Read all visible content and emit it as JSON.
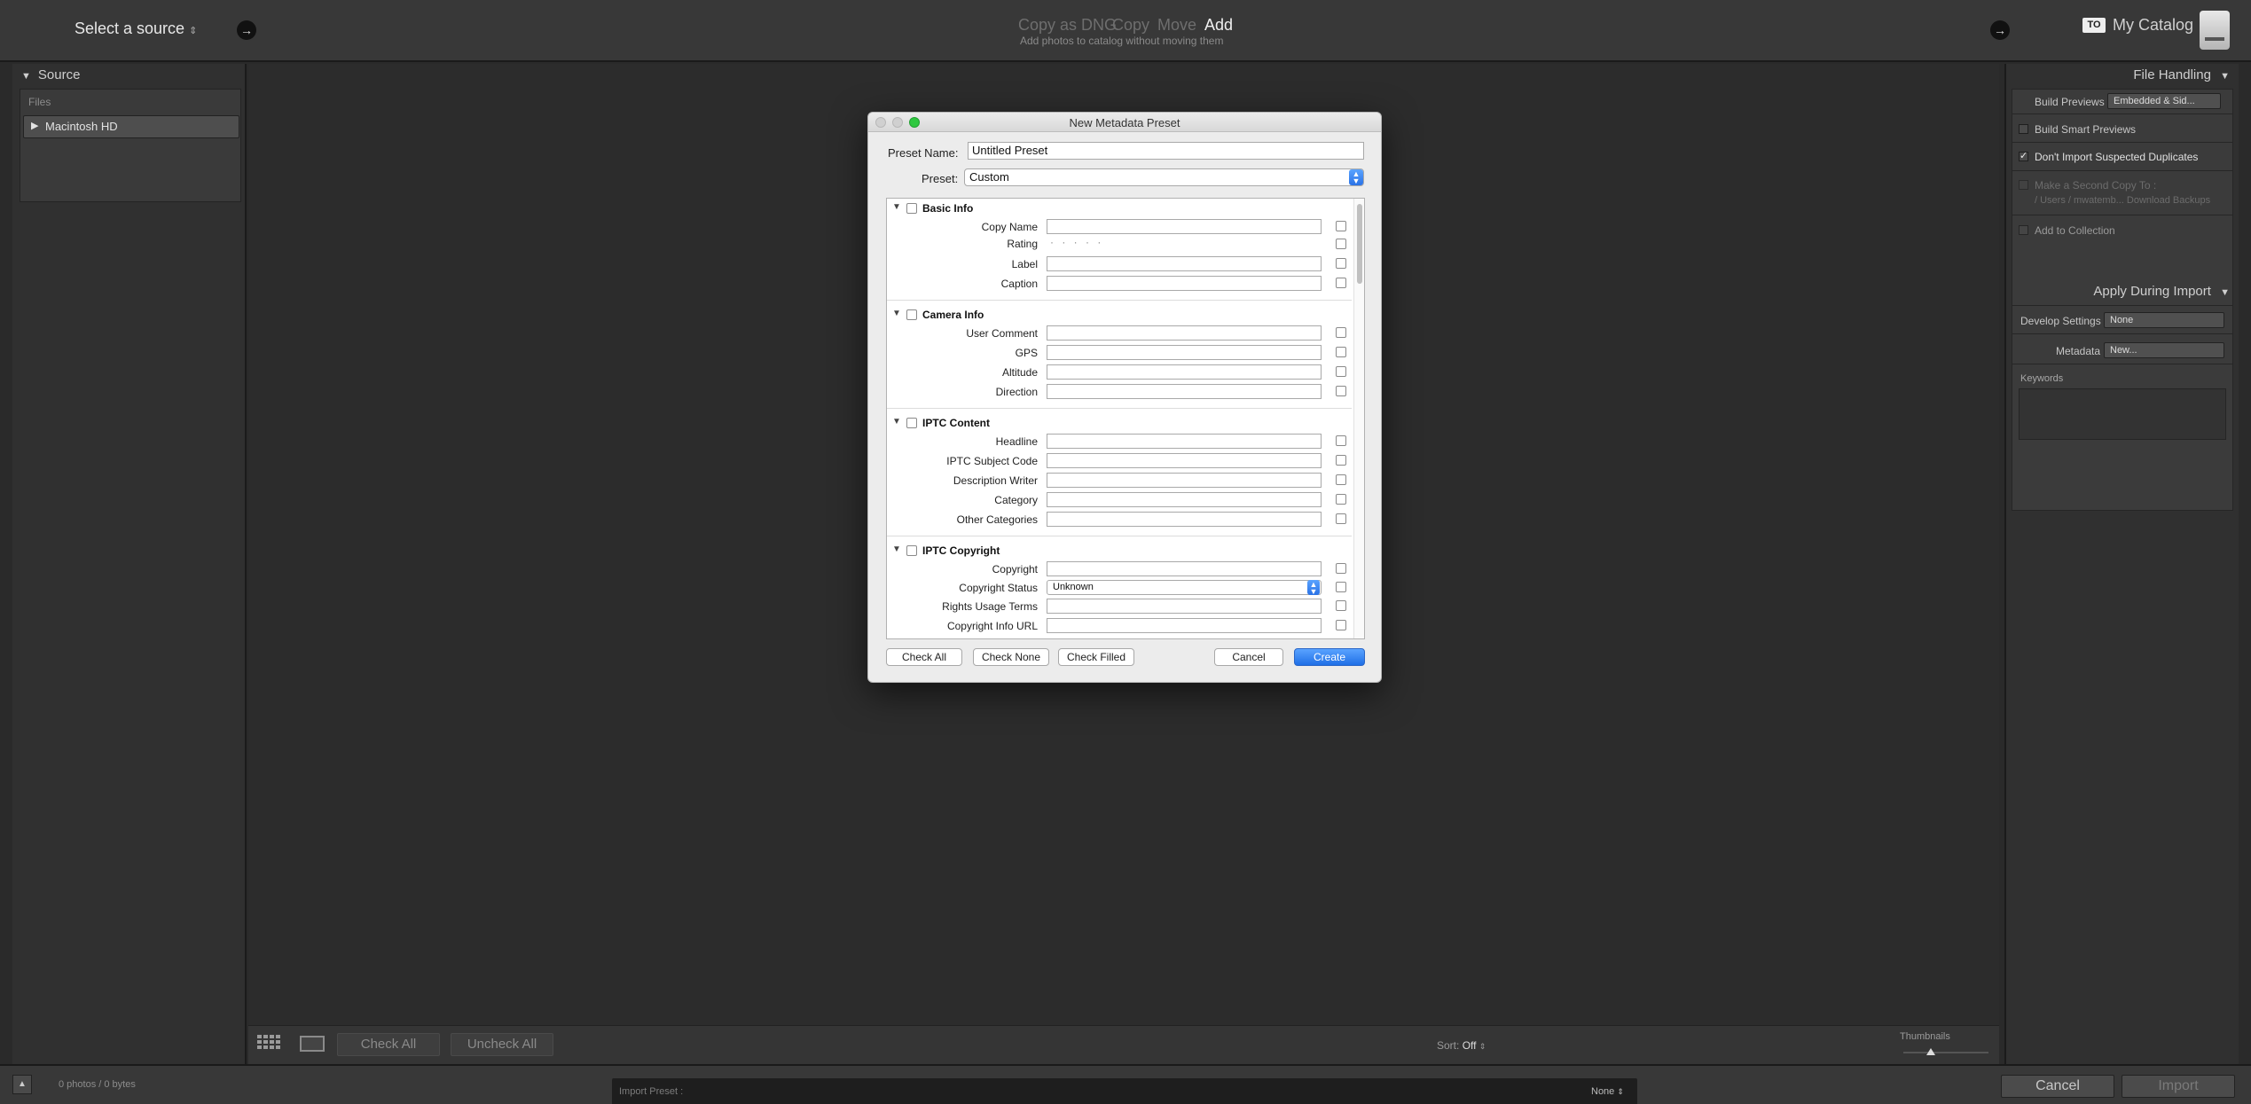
{
  "top": {
    "source_label": "Select a source",
    "modes": [
      "Copy as DNG",
      "Copy",
      "Move",
      "Add"
    ],
    "mode_subtitle": "Add photos to catalog without moving them",
    "to_badge": "TO",
    "catalog": "My Catalog"
  },
  "left": {
    "header": "Source",
    "files_label": "Files",
    "disk": "Macintosh HD"
  },
  "center": {
    "check_all": "Check All",
    "uncheck_all": "Uncheck All",
    "sort_label": "Sort:",
    "sort_value": "Off",
    "thumbnails_label": "Thumbnails"
  },
  "right": {
    "file_handling_header": "File Handling",
    "build_previews_label": "Build Previews",
    "build_previews_value": "Embedded & Sid...",
    "build_smart_previews": "Build Smart Previews",
    "dont_import_duplicates": "Don't Import Suspected Duplicates",
    "make_second_copy": "Make a Second Copy To :",
    "second_copy_path": "/ Users / mwatemb... Download Backups",
    "add_to_collection": "Add to Collection",
    "apply_header": "Apply During Import",
    "develop_settings_label": "Develop Settings",
    "develop_settings_value": "None",
    "metadata_label": "Metadata",
    "metadata_value": "New...",
    "keywords_label": "Keywords"
  },
  "footer": {
    "photo_count": "0 photos / 0 bytes",
    "import_preset_label": "Import Preset :",
    "import_preset_value": "None",
    "cancel": "Cancel",
    "import": "Import"
  },
  "dialog": {
    "title": "New Metadata Preset",
    "preset_name_label": "Preset Name:",
    "preset_name_value": "Untitled Preset",
    "preset_label": "Preset:",
    "preset_value": "Custom",
    "sections": {
      "basic": {
        "title": "Basic Info",
        "fields": [
          "Copy Name",
          "Rating",
          "Label",
          "Caption"
        ]
      },
      "camera": {
        "title": "Camera Info",
        "fields": [
          "User Comment",
          "GPS",
          "Altitude",
          "Direction"
        ]
      },
      "iptc_content": {
        "title": "IPTC Content",
        "fields": [
          "Headline",
          "IPTC Subject Code",
          "Description Writer",
          "Category",
          "Other Categories"
        ]
      },
      "iptc_copyright": {
        "title": "IPTC Copyright",
        "fields": [
          "Copyright",
          "Copyright Status",
          "Rights Usage Terms",
          "Copyright Info URL"
        ],
        "copyright_status_value": "Unknown"
      }
    },
    "rating_dots": "· · · · ·",
    "buttons": {
      "check_all": "Check All",
      "check_none": "Check None",
      "check_filled": "Check Filled",
      "cancel": "Cancel",
      "create": "Create"
    }
  }
}
